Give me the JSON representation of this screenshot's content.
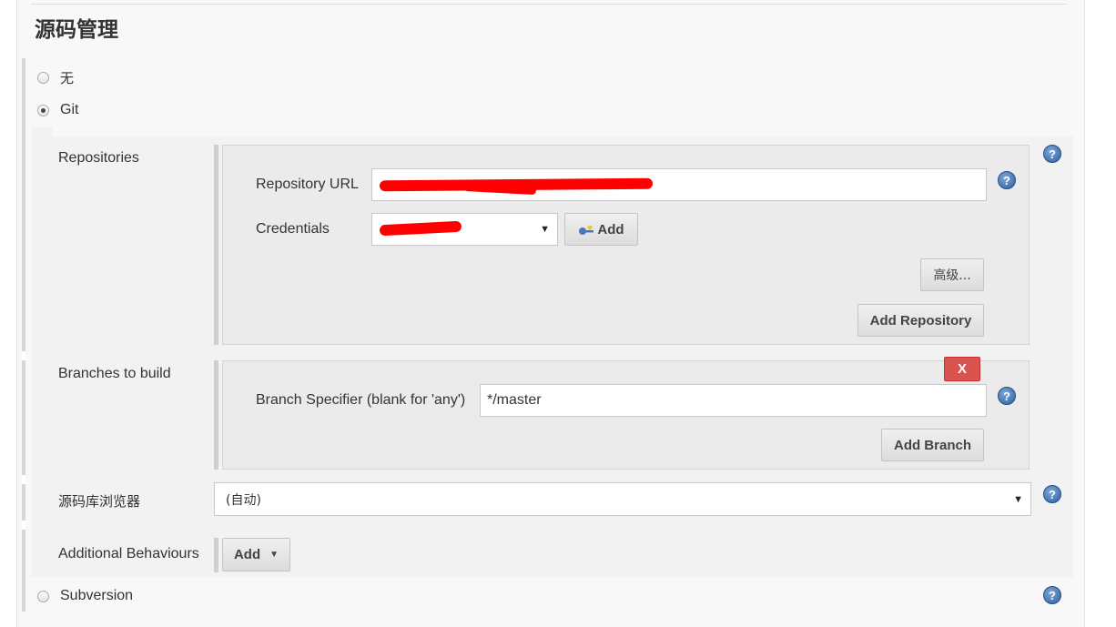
{
  "page": {
    "title": "源码管理"
  },
  "scm": {
    "options": {
      "none": "无",
      "git": "Git",
      "subversion": "Subversion"
    },
    "selected": "git"
  },
  "git": {
    "repositories": {
      "section_label": "Repositories",
      "url_label": "Repository URL",
      "credentials_label": "Credentials",
      "add_credentials_label": "Add",
      "advanced_label": "高级...",
      "add_repository_label": "Add Repository"
    },
    "branches": {
      "section_label": "Branches to build",
      "delete_label": "X",
      "specifier_label": "Branch Specifier (blank for 'any')",
      "specifier_value": "*/master",
      "add_branch_label": "Add Branch"
    },
    "browser": {
      "section_label": "源码库浏览器",
      "value": "(自动)"
    },
    "behaviours": {
      "section_label": "Additional Behaviours",
      "add_label": "Add"
    }
  },
  "icons": {
    "help": "help-icon",
    "key": "key-icon",
    "dropdown": "dropdown-arrow-icon"
  },
  "colors": {
    "delete_button": "#d9534f",
    "help_icon": "#2f5f9e",
    "redaction": "#ff0000"
  }
}
